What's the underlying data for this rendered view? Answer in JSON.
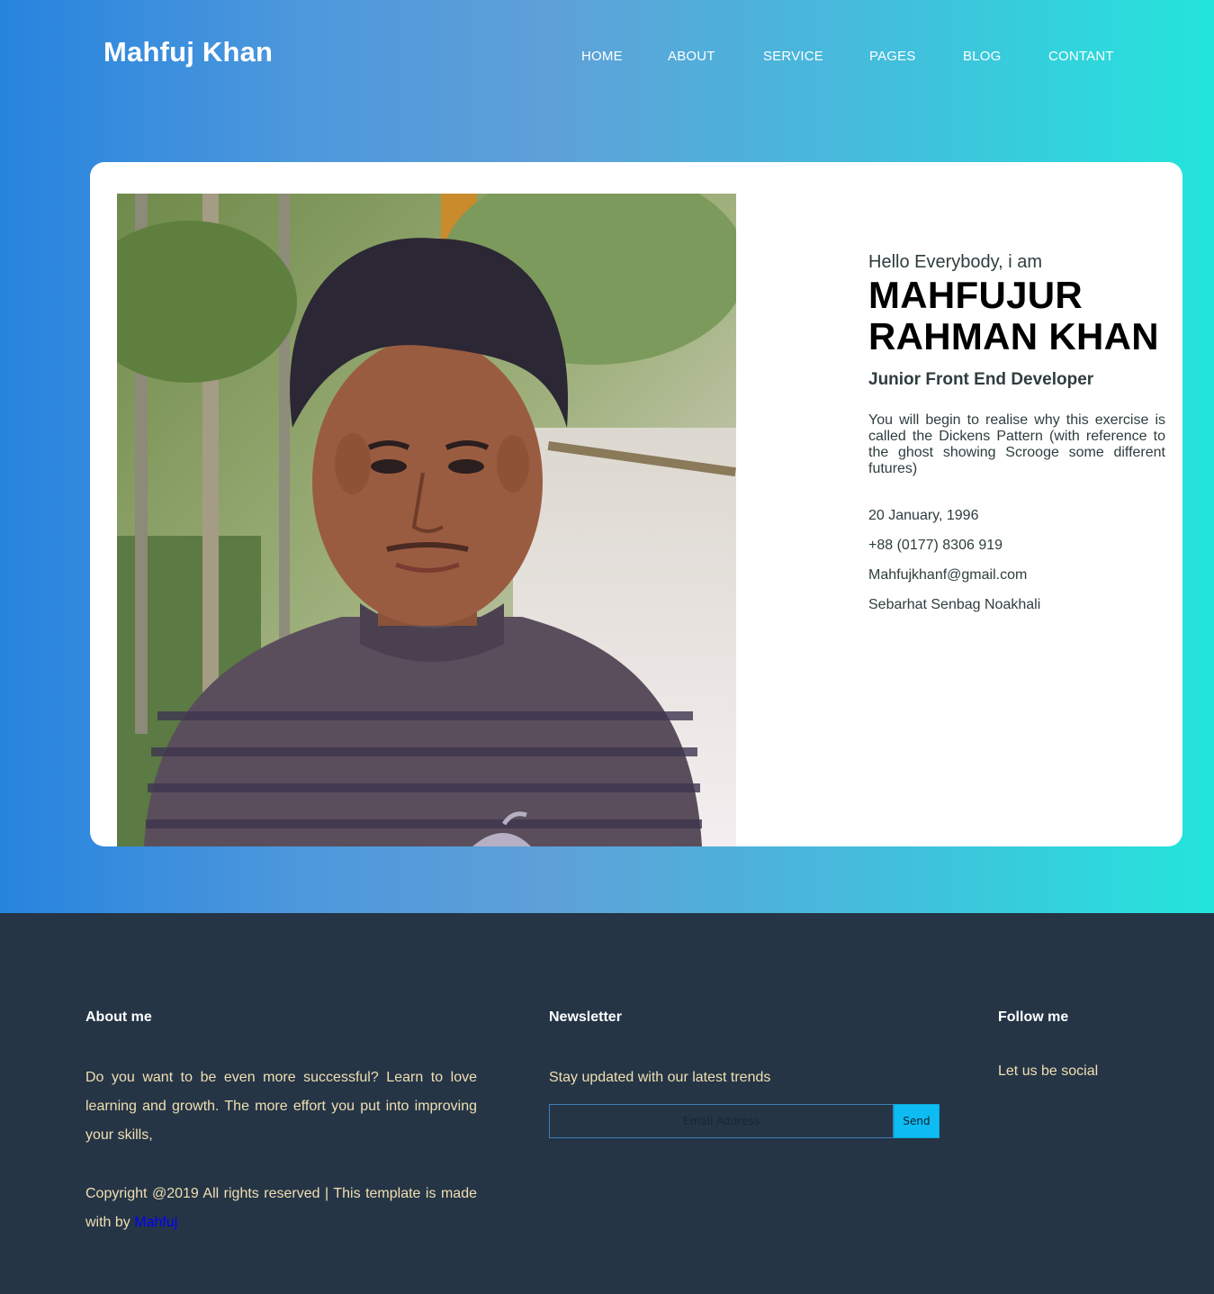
{
  "header": {
    "brand": "Mahfuj Khan",
    "nav": [
      "HOME",
      "ABOUT",
      "SERVICE",
      "PAGES",
      "BLOG",
      "CONTANT"
    ]
  },
  "profile": {
    "greeting": "Hello Everybody, i am",
    "name_line1": "MAHFUJUR",
    "name_line2": "RAHMAN KHAN",
    "role": "Junior Front End Developer",
    "description": "You will begin to realise why this exercise is called the Dickens Pattern (with reference to the ghost showing Scrooge some different futures)",
    "birthdate": "20 January, 1996",
    "phone": "+88 (0177) 8306 919",
    "email": "Mahfujkhanf@gmail.com",
    "address": "Sebarhat Senbag Noakhali"
  },
  "footer": {
    "about": {
      "title": "About me",
      "text": "Do you want to be even more successful? Learn to love learning and growth. The more effort you put into improving your skills,",
      "copyright": "Copyright @2019 All rights reserved | This template is made with by",
      "author_link": "Mahfuj"
    },
    "newsletter": {
      "title": "Newsletter",
      "text": "Stay updated with our latest trends",
      "email_placeholder": "Email Address",
      "send_label": "Send"
    },
    "follow": {
      "title": "Follow me",
      "text": "Let us be social"
    }
  },
  "colors": {
    "gradient_start": "#2784de",
    "gradient_end": "#23e5db",
    "footer_bg": "#253546",
    "footer_text": "#f1dfb2",
    "send_button": "#0dbcf3"
  }
}
